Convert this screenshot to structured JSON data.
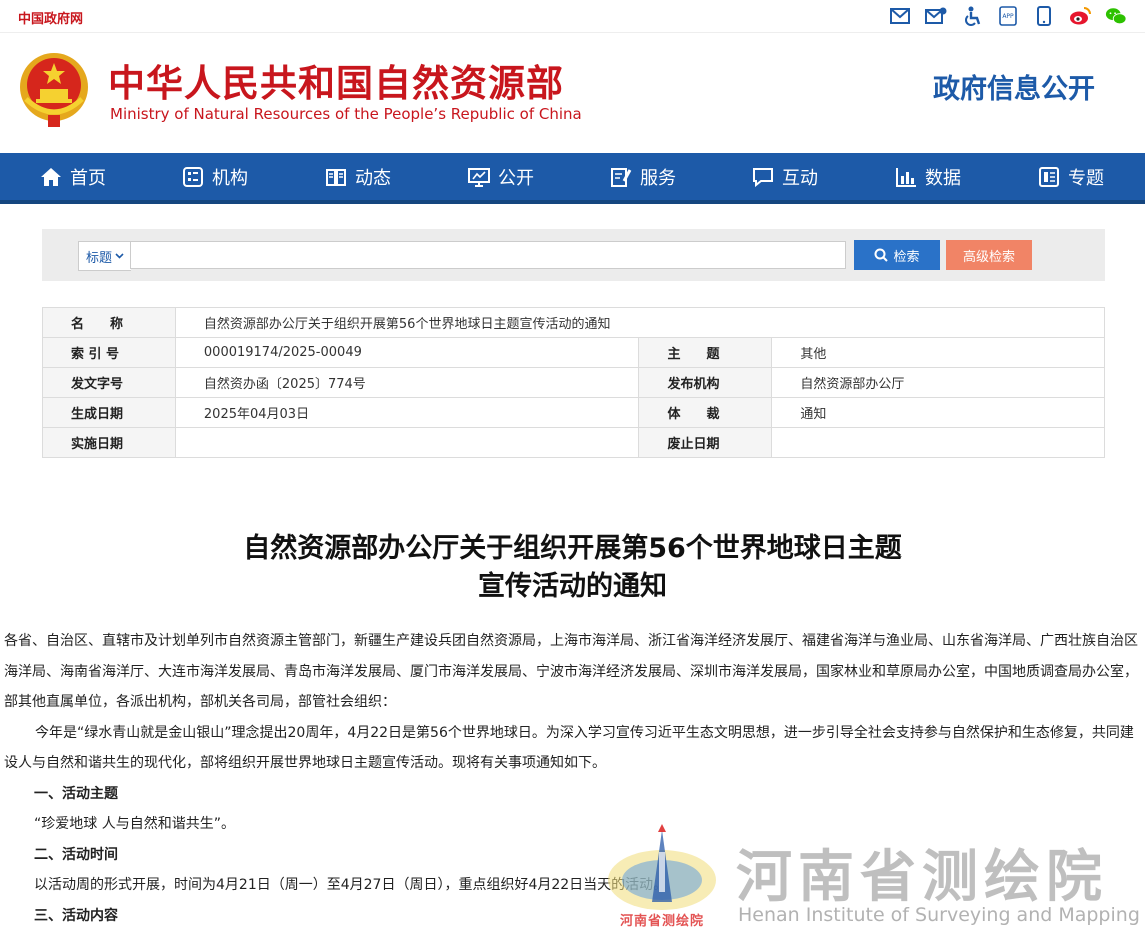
{
  "topbar": {
    "gov_link": "中国政府网",
    "icons": [
      "mail-icon",
      "email-icon",
      "accessibility-icon",
      "app-icon",
      "mobile-icon",
      "weibo-icon",
      "wechat-icon"
    ]
  },
  "header": {
    "cn_name": "中华人民共和国自然资源部",
    "en_name": "Ministry of Natural Resources of the People’s Republic of China",
    "gov_info": "政府信息公开"
  },
  "nav": {
    "items": [
      {
        "label": "首页",
        "icon": "home-icon"
      },
      {
        "label": "机构",
        "icon": "org-icon"
      },
      {
        "label": "动态",
        "icon": "book-icon"
      },
      {
        "label": "公开",
        "icon": "monitor-icon"
      },
      {
        "label": "服务",
        "icon": "edit-icon"
      },
      {
        "label": "互动",
        "icon": "chat-icon"
      },
      {
        "label": "数据",
        "icon": "chart-icon"
      },
      {
        "label": "专题",
        "icon": "topic-icon"
      }
    ]
  },
  "search": {
    "select_label": "标题",
    "input_value": "",
    "search_label": "检索",
    "advanced_label": "高级检索"
  },
  "meta": {
    "name_label": "名　　称",
    "name_value": "自然资源部办公厅关于组织开展第56个世界地球日主题宣传活动的通知",
    "index_label": "索 引 号",
    "index_value": "000019174/2025-00049",
    "subject_label": "主　　题",
    "subject_value": "其他",
    "docno_label": "发文字号",
    "docno_value": "自然资办函〔2025〕774号",
    "issuer_label": "发布机构",
    "issuer_value": "自然资源部办公厅",
    "created_label": "生成日期",
    "created_value": "2025年04月03日",
    "genre_label": "体　　裁",
    "genre_value": "通知",
    "effective_label": "实施日期",
    "effective_value": "",
    "abolish_label": "废止日期",
    "abolish_value": ""
  },
  "doc": {
    "title_line1": "自然资源部办公厅关于组织开展第56个世界地球日主题",
    "title_line2": "宣传活动的通知",
    "recipients": "各省、自治区、直辖市及计划单列市自然资源主管部门，新疆生产建设兵团自然资源局，上海市海洋局、浙江省海洋经济发展厅、福建省海洋与渔业局、山东省海洋局、广西壮族自治区海洋局、海南省海洋厅、大连市海洋发展局、青岛市海洋发展局、厦门市海洋发展局、宁波市海洋经济发展局、深圳市海洋发展局，国家林业和草原局办公室，中国地质调查局办公室，部其他直属单位，各派出机构，部机关各司局，部管社会组织：",
    "intro": "今年是“绿水青山就是金山银山”理念提出20周年，4月22日是第56个世界地球日。为深入学习宣传习近平生态文明思想，进一步引导全社会支持参与自然保护和生态修复，共同建设人与自然和谐共生的现代化，部将组织开展世界地球日主题宣传活动。现将有关事项通知如下。",
    "sec1": "一、活动主题",
    "sec1_text": "“珍爱地球 人与自然和谐共生”。",
    "sec2": "二、活动时间",
    "sec2_text": "以活动周的形式开展，时间为4月21日（周一）至4月27日（周日），重点组织好4月22日当天的活动。",
    "sec3": "三、活动内容"
  },
  "watermark": {
    "cn": "河南省测绘院",
    "en": "Henan Institute of Surveying and Mapping",
    "logo_text": "河南省测绘院"
  },
  "colors": {
    "brand_red": "#c8161d",
    "brand_blue": "#1d5aa8",
    "search_btn": "#2a72c8",
    "advanced_btn": "#f18466"
  }
}
